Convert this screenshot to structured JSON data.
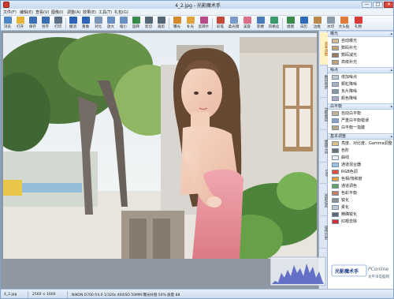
{
  "window": {
    "title": "4_2.jpg - 光影魔术手",
    "minimize_glyph": "—",
    "maximize_glyph": "□",
    "close_glyph": "✕"
  },
  "menu": [
    "文件(F)",
    "编辑(E)",
    "查看(V)",
    "图像(I)",
    "调整(A)",
    "效果(E)",
    "工具(T)",
    "礼包(G)"
  ],
  "toolbar": [
    {
      "label": "浏览",
      "color": "#4f86c6"
    },
    {
      "label": "打开",
      "color": "#e4b33a"
    },
    {
      "label": "保存",
      "color": "#3c6fb2"
    },
    {
      "label": "另存",
      "color": "#3c6fb2"
    },
    {
      "label": "打印",
      "color": "#5b6f86"
    },
    {
      "label": "撤消",
      "color": "#2e64b8"
    },
    {
      "label": "重做",
      "color": "#2e64b8"
    },
    {
      "label": "对比",
      "color": "#7d96b8"
    },
    {
      "label": "放大",
      "color": "#6a8fc2"
    },
    {
      "label": "缩小",
      "color": "#6a8fc2"
    },
    {
      "label": "旋转",
      "color": "#3a8a4a"
    },
    {
      "label": "剪切",
      "color": "#556677"
    },
    {
      "label": "裁剪",
      "color": "#556677"
    },
    {
      "label": "曝光",
      "color": "#d28a2a"
    },
    {
      "label": "补光",
      "color": "#e0a23a"
    },
    {
      "label": "反转片",
      "color": "#b84a8a"
    },
    {
      "label": "彩笔",
      "color": "#c44a3a"
    },
    {
      "label": "柔光镜",
      "color": "#7a9ac8"
    },
    {
      "label": "美容",
      "color": "#d8708a"
    },
    {
      "label": "影楼",
      "color": "#4a7ab8"
    },
    {
      "label": "风格化",
      "color": "#3a9a6a"
    },
    {
      "label": "组图",
      "color": "#3a8a4a"
    },
    {
      "label": "日历",
      "color": "#2e6ab8"
    },
    {
      "label": "边框",
      "color": "#b8884a"
    },
    {
      "label": "水印",
      "color": "#8a9aaa"
    },
    {
      "label": "大头贴",
      "color": "#e07a3a"
    },
    {
      "label": "礼物",
      "color": "#d83a3a"
    }
  ],
  "side_tabs": [
    "基本调整",
    "数码暗房",
    "边框图层",
    "便捷工具",
    "EXIF",
    "光影社区",
    "操作历史"
  ],
  "panel": {
    "sections": [
      {
        "title": "曝光",
        "items": [
          {
            "label": "自动曝光",
            "color": "#d9b98a"
          },
          {
            "label": "数码补光",
            "color": "#c8a070"
          },
          {
            "label": "数码减光",
            "color": "#9a7a5a"
          },
          {
            "label": "高级补光",
            "color": "#caa070"
          }
        ]
      },
      {
        "title": "噪点",
        "items": [
          {
            "label": "增加噪点",
            "color": "#bfc6cc"
          },
          {
            "label": "颗粒降噪",
            "color": "#a8b0b8"
          },
          {
            "label": "负片降噪",
            "color": "#8c96a0"
          },
          {
            "label": "颜色降噪",
            "color": "#b0a8c0"
          }
        ]
      },
      {
        "title": "白平衡",
        "items": [
          {
            "label": "自动白平衡",
            "color": "#c7b28a"
          },
          {
            "label": "严重白平衡错误",
            "color": "#8aa0c8"
          },
          {
            "label": "白平衡一指键",
            "color": "#b8a888"
          }
        ]
      },
      {
        "title": "基本调整",
        "items": [
          {
            "label": "亮度、对比度、Gamma调整",
            "color": "#e0c080"
          },
          {
            "label": "色阶",
            "color": "#707070"
          },
          {
            "label": "曲线",
            "color": "#f0f0f0"
          },
          {
            "label": "通道混合器",
            "color": "#a0c0e0"
          },
          {
            "label": "RGB色调",
            "color": "#e05040"
          },
          {
            "label": "色相/饱和度",
            "color": "#e0a040"
          },
          {
            "label": "通道调色",
            "color": "#60a060"
          },
          {
            "label": "色彩平衡",
            "color": "#c08060"
          },
          {
            "label": "锐化",
            "color": "#909090"
          },
          {
            "label": "柔化",
            "color": "#c0c8d0"
          },
          {
            "label": "精确锐化",
            "color": "#606870"
          },
          {
            "label": "红眼去除",
            "color": "#d03030"
          }
        ]
      }
    ]
  },
  "status": {
    "file": "4_2.jpg",
    "size": "2560 × 1600",
    "exif": "NIKON D700 f/4.0 1/320s 400ISO 50MM 曝光补偿 50% 质量 88"
  },
  "watermark": {
    "brand": "光影魔术手",
    "site": "PConline",
    "sub": "太平洋电脑网"
  },
  "colors": {
    "window_border": "#7ea6cf",
    "active_tab": "#fff3c4",
    "workspace_bg": "#8f98a2"
  }
}
